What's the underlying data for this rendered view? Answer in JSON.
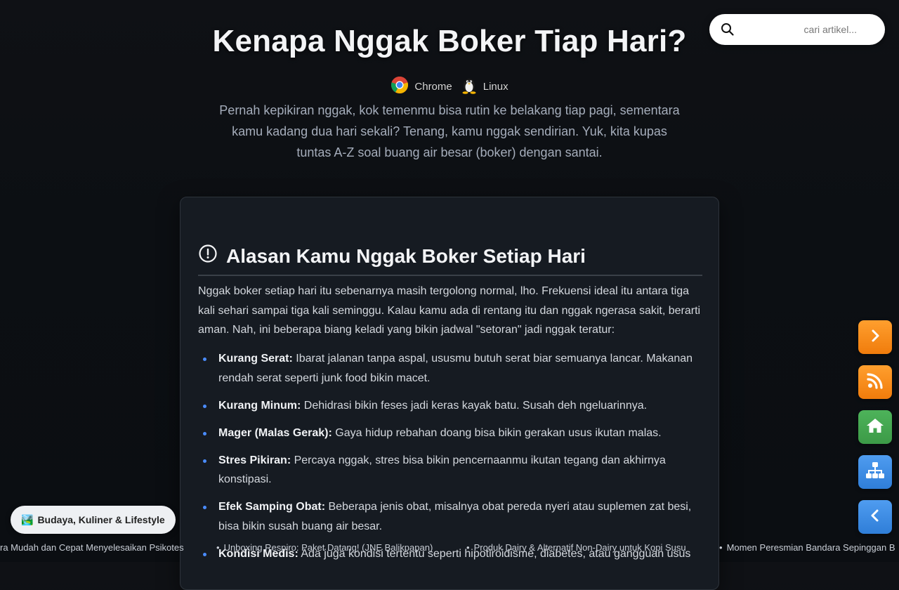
{
  "header": {
    "title": "Kenapa Nggak Boker Tiap Hari?",
    "meta": [
      {
        "label": "Chrome",
        "icon": "chrome-icon"
      },
      {
        "label": "Linux",
        "icon": "linux-tux-icon"
      }
    ],
    "intro": "Pernah kepikiran nggak, kok temenmu bisa rutin ke belakang tiap pagi, sementara kamu kadang dua hari sekali? Tenang, kamu nggak sendirian. Yuk, kita kupas tuntas A-Z soal buang air besar (boker) dengan santai."
  },
  "search": {
    "placeholder": "cari artikel...",
    "icon": "search-icon"
  },
  "article": {
    "section_title": "Alasan Kamu Nggak Boker Setiap Hari",
    "section_icon": "exclamation-circle-icon",
    "paragraph": "Nggak boker setiap hari itu sebenarnya masih tergolong normal, lho. Frekuensi ideal itu antara tiga kali sehari sampai tiga kali seminggu. Kalau kamu ada di rentang itu dan nggak ngerasa sakit, berarti aman. Nah, ini beberapa biang keladi yang bikin jadwal \"setoran\" jadi nggak teratur:",
    "items": [
      {
        "term": "Kurang Serat:",
        "text": "Ibarat jalanan tanpa aspal, ususmu butuh serat biar semuanya lancar. Makanan rendah serat seperti junk food bikin macet."
      },
      {
        "term": "Kurang Minum:",
        "text": "Dehidrasi bikin feses jadi keras kayak batu. Susah deh ngeluarinnya."
      },
      {
        "term": "Mager (Malas Gerak):",
        "text": "Gaya hidup rebahan doang bisa bikin gerakan usus ikutan malas."
      },
      {
        "term": "Stres Pikiran:",
        "text": "Percaya nggak, stres bisa bikin pencernaanmu ikutan tegang dan akhirnya konstipasi."
      },
      {
        "term": "Efek Samping Obat:",
        "text": "Beberapa jenis obat, misalnya obat pereda nyeri atau suplemen zat besi, bisa bikin susah buang air besar."
      },
      {
        "term": "Kondisi Medis:",
        "text": "Ada juga kondisi tertentu seperti hipotiroidisme, diabetes, atau gangguan usus"
      }
    ]
  },
  "fabs": [
    {
      "icon": "chevron-right-icon",
      "color": "#f7901e"
    },
    {
      "icon": "rss-icon",
      "color": "#f7901e"
    },
    {
      "icon": "home-icon",
      "color": "#43a84f"
    },
    {
      "icon": "sitemap-icon",
      "color": "#3a8ae6"
    },
    {
      "icon": "chevron-left-icon",
      "color": "#3a8ae6"
    }
  ],
  "category_chip": {
    "emoji": "🏞️",
    "label": "Budaya, Kuliner & Lifestyle"
  },
  "ticker": [
    "ra Mudah dan Cepat Menyelesaikan Psikotes",
    "Unboxing Respiro: Paket Datang! (JNE Balikpapan)",
    "Produk Dairy & Alternatif Non-Dairy untuk Kopi Susu",
    "Momen Peresmian Bandara Sepinggan B"
  ]
}
